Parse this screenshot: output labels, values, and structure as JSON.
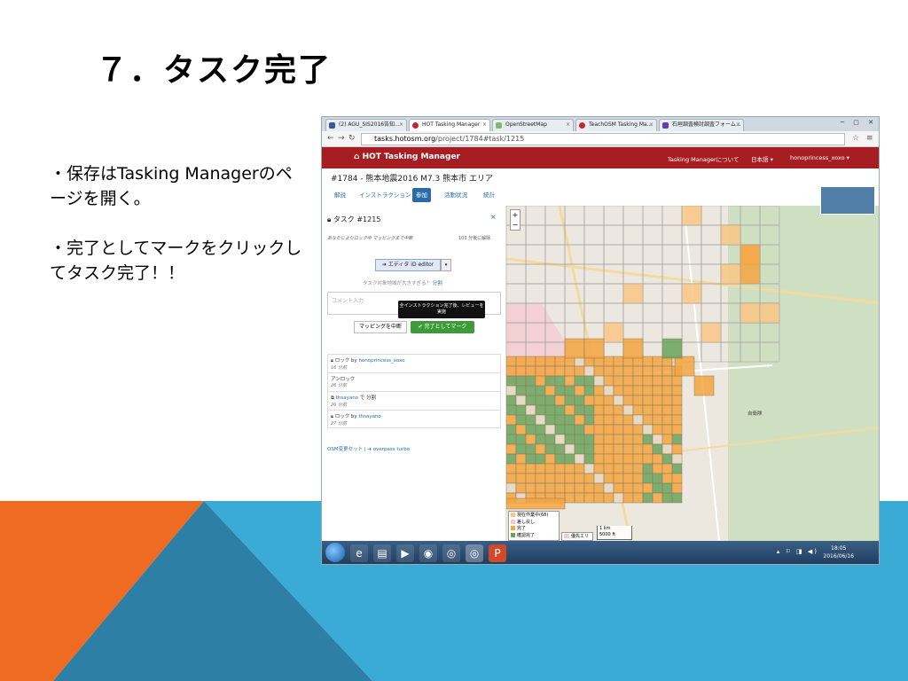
{
  "slide": {
    "title": "７．タスク完了",
    "bullet1": "・保存はTasking Managerのページを開く。",
    "bullet2": "・完了としてマークをクリックしてタスク完了！！"
  },
  "browser": {
    "tabs": [
      "(2) AGU_SIS2016告知...",
      "HOT Tasking Manager",
      "OpenStreetMap",
      "TeachOSM Tasking Ma...",
      "石垣調査検討調査フォーム..."
    ],
    "window_controls": "─ ▢ ✕",
    "url_host": "tasks.hotosm.org",
    "url_path": "/project/1784#task/1215"
  },
  "app": {
    "brand": "HOT Tasking Manager",
    "nav_about": "Tasking Managerについて",
    "nav_lang": "日本語 ▾",
    "nav_user": "honoprincess_xoxo ▾",
    "project_title": "#1784 - 熊本地震2016 M7.3 熊本市 エリア",
    "subnav": [
      "解説",
      "インストラクション",
      "参加",
      "活動状況",
      "統計"
    ]
  },
  "task": {
    "title": "タスク #1215",
    "close": "×",
    "locked_note": "あなたによりロック中 マッピングまで中断",
    "lock_time": "103 分後に解除",
    "editor_button": "➜ エディタ iD editor",
    "editor_dropdown": "▾",
    "split_note": "タスク対象地域が大きすぎる？",
    "split_link": "分割",
    "comment_placeholder": "コメント入力",
    "tooltip": "全インストラクション完了後、レビューを実施",
    "stop_button": "マッピングを中断",
    "done_button": "✔ 完了としてマーク",
    "history": [
      {
        "action": "ロック by",
        "user": "honoprincess_xoxo",
        "time": "16 分前"
      },
      {
        "action": "アンロック",
        "user": "",
        "time": "26 分前"
      },
      {
        "action": "",
        "user": "thsayano",
        "suffix": "で 分割",
        "time": "26 分前"
      },
      {
        "action": "ロック by",
        "user": "thsayano",
        "time": "27 分前"
      }
    ],
    "osm_links": "OSM変更セット | ➜ overpass turbo"
  },
  "map": {
    "legend": [
      "現在作業中(68)",
      "差し戻し",
      "完了",
      "確認完了"
    ],
    "legend_priority": "優先エリア",
    "scale_km": "1 km",
    "scale_ft": "5000 ft",
    "place": "自衛隊",
    "colors": {
      "done": "#f4a53f",
      "validated": "#6ba35a",
      "invalidated": "#f6c7cc",
      "current": "#f8c88a"
    }
  },
  "taskbar": {
    "time": "18:05",
    "date": "2016/06/16"
  }
}
